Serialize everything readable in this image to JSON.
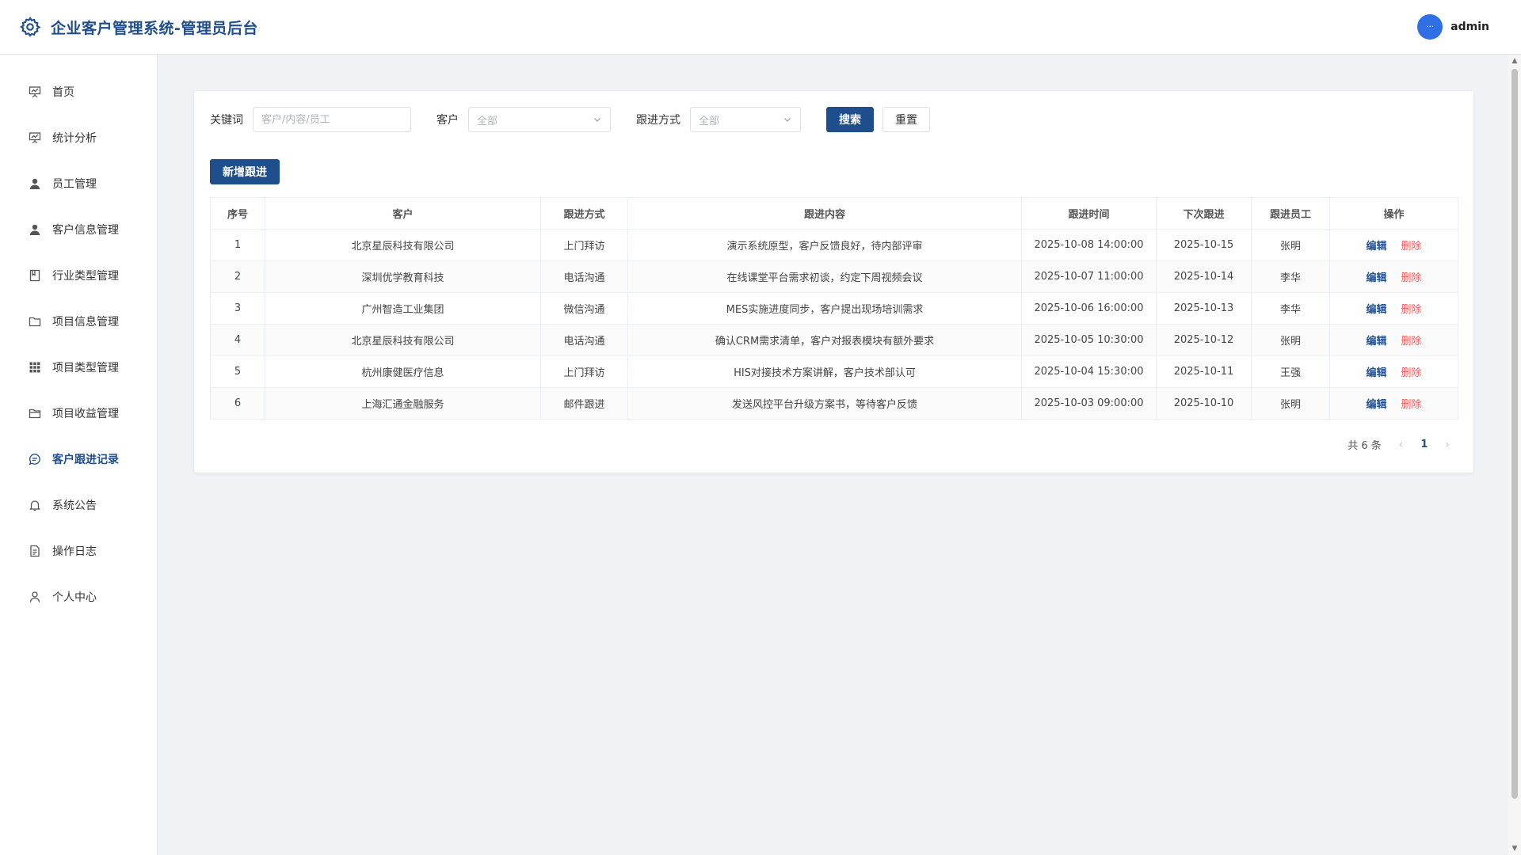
{
  "header": {
    "title": "企业客户管理系统-管理员后台",
    "user": {
      "avatar_text": "···",
      "name": "admin"
    }
  },
  "sidebar": {
    "items": [
      {
        "label": "首页",
        "icon": "presentation-icon"
      },
      {
        "label": "统计分析",
        "icon": "chart-icon"
      },
      {
        "label": "员工管理",
        "icon": "user-icon"
      },
      {
        "label": "客户信息管理",
        "icon": "user-icon"
      },
      {
        "label": "行业类型管理",
        "icon": "notebook-icon"
      },
      {
        "label": "项目信息管理",
        "icon": "folder-icon"
      },
      {
        "label": "项目类型管理",
        "icon": "grid-icon"
      },
      {
        "label": "项目收益管理",
        "icon": "folder-opened-icon"
      },
      {
        "label": "客户跟进记录",
        "icon": "chat-icon",
        "active": true
      },
      {
        "label": "系统公告",
        "icon": "bell-icon"
      },
      {
        "label": "操作日志",
        "icon": "document-icon"
      },
      {
        "label": "个人中心",
        "icon": "user-outline-icon"
      }
    ]
  },
  "filters": {
    "keyword_label": "关键词",
    "keyword_placeholder": "客户/内容/员工",
    "customer_label": "客户",
    "customer_value": "全部",
    "method_label": "跟进方式",
    "method_value": "全部",
    "search_label": "搜索",
    "reset_label": "重置"
  },
  "toolbar": {
    "add_label": "新增跟进"
  },
  "table": {
    "headers": [
      "序号",
      "客户",
      "跟进方式",
      "跟进内容",
      "跟进时间",
      "下次跟进",
      "跟进员工",
      "操作"
    ],
    "edit_label": "编辑",
    "delete_label": "删除",
    "rows": [
      [
        "1",
        "北京星辰科技有限公司",
        "上门拜访",
        "演示系统原型，客户反馈良好，待内部评审",
        "2025-10-08 14:00:00",
        "2025-10-15",
        "张明"
      ],
      [
        "2",
        "深圳优学教育科技",
        "电话沟通",
        "在线课堂平台需求初谈，约定下周视频会议",
        "2025-10-07 11:00:00",
        "2025-10-14",
        "李华"
      ],
      [
        "3",
        "广州智造工业集团",
        "微信沟通",
        "MES实施进度同步，客户提出现场培训需求",
        "2025-10-06 16:00:00",
        "2025-10-13",
        "李华"
      ],
      [
        "4",
        "北京星辰科技有限公司",
        "电话沟通",
        "确认CRM需求清单，客户对报表模块有额外要求",
        "2025-10-05 10:30:00",
        "2025-10-12",
        "张明"
      ],
      [
        "5",
        "杭州康健医疗信息",
        "上门拜访",
        "HIS对接技术方案讲解，客户技术部认可",
        "2025-10-04 15:30:00",
        "2025-10-11",
        "王强"
      ],
      [
        "6",
        "上海汇通金融服务",
        "邮件跟进",
        "发送风控平台升级方案书，等待客户反馈",
        "2025-10-03 09:00:00",
        "2025-10-10",
        "张明"
      ]
    ]
  },
  "pagination": {
    "total_text": "共 6 条",
    "current_page": "1"
  },
  "colors": {
    "brand": "#1f4e8c",
    "danger": "#f05a5a",
    "avatar": "#2f6fe4"
  }
}
